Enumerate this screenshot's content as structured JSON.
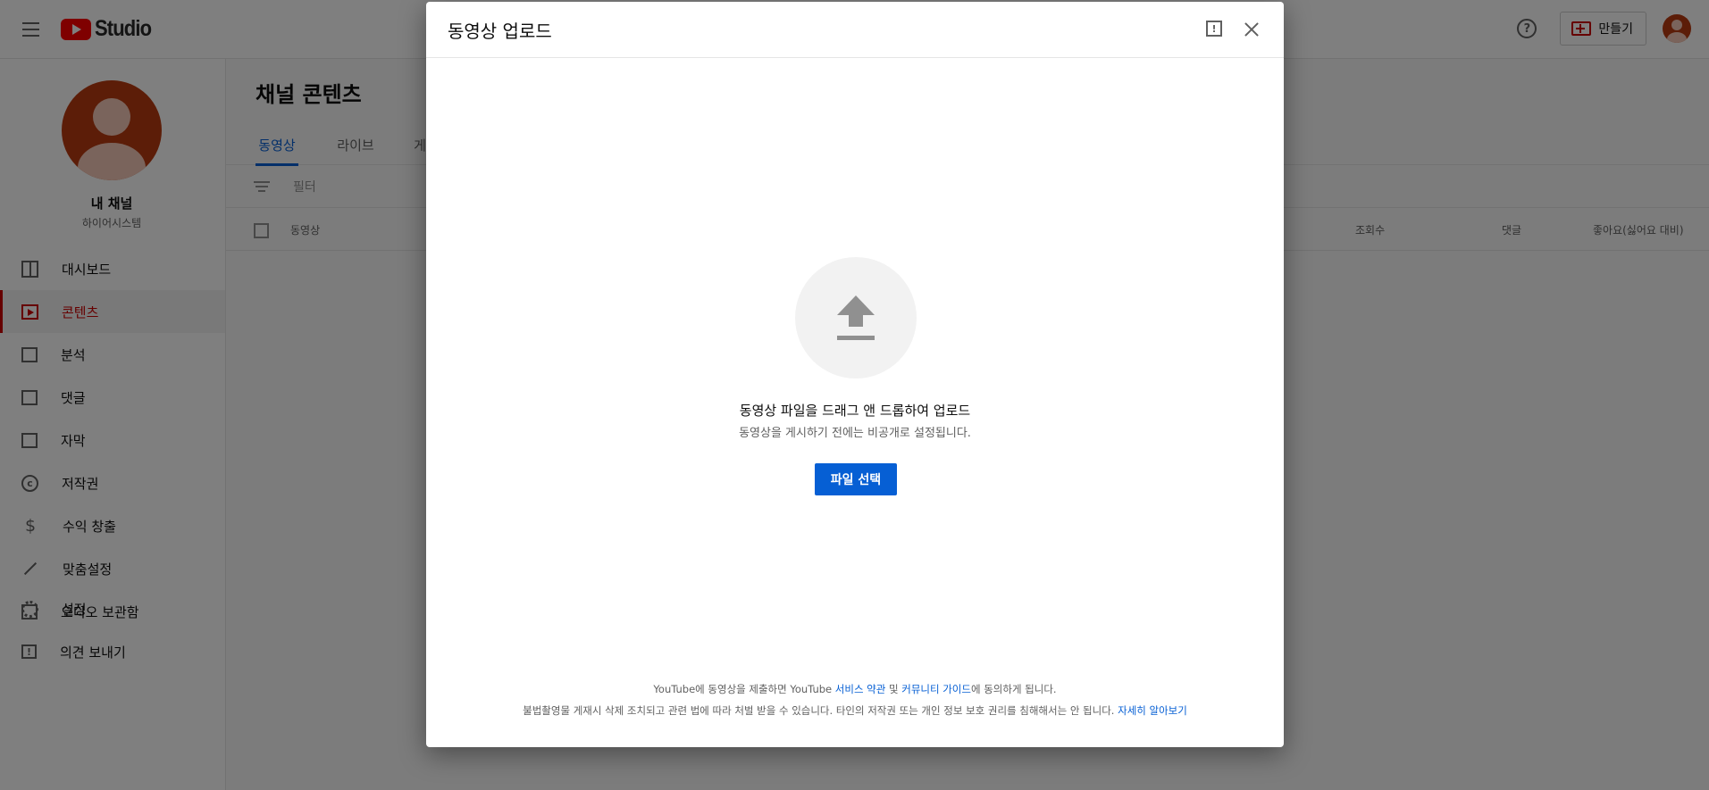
{
  "app": {
    "logo_text": "Studio"
  },
  "topbar": {
    "help_glyph": "?",
    "create_label": "만들기"
  },
  "channel": {
    "name": "내 채널",
    "subtitle": "하이어시스템"
  },
  "sidebar": {
    "items": [
      {
        "label": "대시보드",
        "icon": "dashboard-icon"
      },
      {
        "label": "콘텐츠",
        "icon": "content-icon",
        "active": true
      },
      {
        "label": "분석",
        "icon": "analytics-icon"
      },
      {
        "label": "댓글",
        "icon": "comments-icon"
      },
      {
        "label": "자막",
        "icon": "subtitles-icon"
      },
      {
        "label": "저작권",
        "icon": "copyright-icon"
      },
      {
        "label": "수익 창출",
        "icon": "monetization-icon"
      },
      {
        "label": "맞춤설정",
        "icon": "customization-icon"
      },
      {
        "label": "오디오 보관함",
        "icon": "audio-library-icon"
      }
    ],
    "bottom": [
      {
        "label": "설정",
        "icon": "settings-icon"
      },
      {
        "label": "의견 보내기",
        "icon": "feedback-icon"
      }
    ]
  },
  "main": {
    "title": "채널 콘텐츠",
    "tabs": [
      {
        "label": "동영상",
        "active": true
      },
      {
        "label": "라이브"
      },
      {
        "label": "게"
      }
    ],
    "filter_placeholder": "필터",
    "columns": {
      "video": "동영상",
      "views": "조회수",
      "comments": "댓글",
      "likes": "좋아요(싫어요 대비)"
    }
  },
  "modal": {
    "title": "동영상 업로드",
    "drop_title": "동영상 파일을 드래그 앤 드롭하여 업로드",
    "drop_subtitle": "동영상을 게시하기 전에는 비공개로 설정됩니다.",
    "select_button": "파일 선택",
    "legal_line1": {
      "prefix": "YouTube에 동영상을 제출하면 YouTube ",
      "terms_link": "서비스 약관",
      "and": " 및 ",
      "guidelines_link": "커뮤니티 가이드",
      "suffix": "에 동의하게 됩니다."
    },
    "legal_line2": {
      "text": "불법촬영물 게재시 삭제 조치되고 관련 법에 따라 처벌 받을 수 있습니다. 타인의 저작권 또는 개인 정보 보호 권리를 침해해서는 안 됩니다. ",
      "learn_more_link": "자세히 알아보기"
    }
  },
  "colors": {
    "accent": "#065fd4",
    "brand_red": "#ff0000",
    "active_red": "#cc0000",
    "overlay": "rgba(0,0,0,0.5)"
  }
}
